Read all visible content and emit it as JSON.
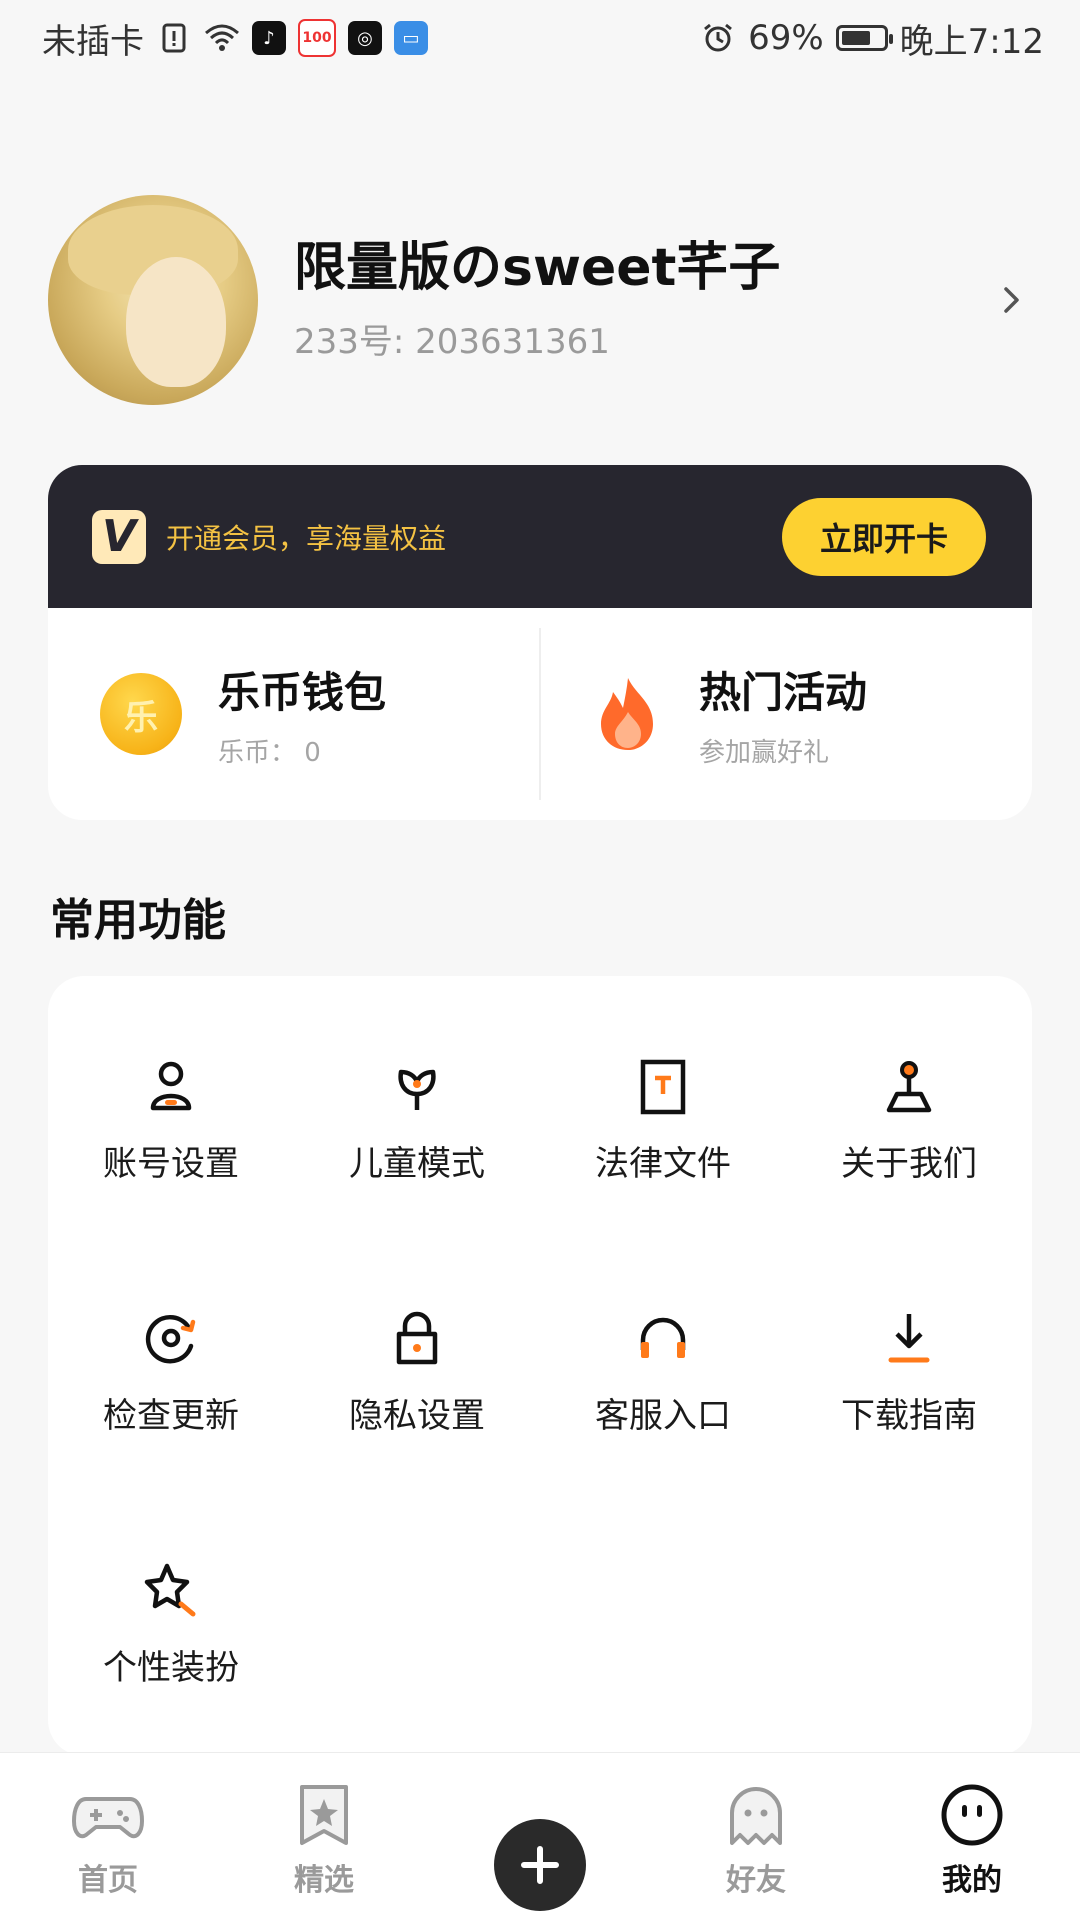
{
  "status_bar": {
    "carrier": "未插卡",
    "battery": "69%",
    "battery_level": 0.69,
    "time": "晚上7:12",
    "app_icons": [
      "tiktok-icon",
      "score-100-icon",
      "app-d-icon",
      "wallet-icon"
    ]
  },
  "profile": {
    "username": "限量版のsweet芊子",
    "user_id": "233号: 203631361"
  },
  "vip": {
    "logo_text": "V",
    "promo_text": "开通会员，享海量权益",
    "button_label": "立即开卡",
    "wallet_title": "乐币钱包",
    "wallet_sub": "乐币：  0",
    "coin_glyph": "乐",
    "activity_title": "热门活动",
    "activity_sub": "参加赢好礼"
  },
  "section_title": "常用功能",
  "functions": [
    {
      "label": "账号设置",
      "icon": "account-settings-icon"
    },
    {
      "label": "儿童模式",
      "icon": "kids-mode-icon"
    },
    {
      "label": "法律文件",
      "icon": "legal-document-icon"
    },
    {
      "label": "关于我们",
      "icon": "about-us-icon"
    },
    {
      "label": "检查更新",
      "icon": "check-update-icon"
    },
    {
      "label": "隐私设置",
      "icon": "privacy-lock-icon"
    },
    {
      "label": "客服入口",
      "icon": "headset-icon"
    },
    {
      "label": "下载指南",
      "icon": "download-icon"
    },
    {
      "label": "个性装扮",
      "icon": "star-decorate-icon"
    }
  ],
  "nav": {
    "home": "首页",
    "featured": "精选",
    "friends": "好友",
    "me": "我的"
  },
  "colors": {
    "accent_orange": "#ff7a1a",
    "vip_yellow": "#fdd131",
    "vip_dark": "#27262f"
  }
}
